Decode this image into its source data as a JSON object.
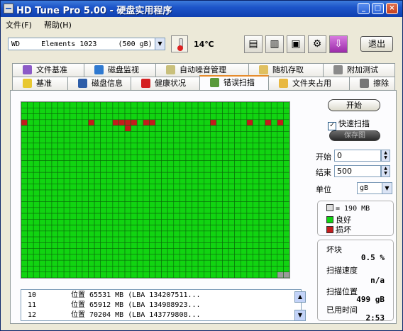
{
  "window": {
    "title": "HD Tune Pro 5.00 - 硬盘实用程序"
  },
  "menubar": {
    "items": [
      "文件(F)",
      "帮助(H)"
    ]
  },
  "toolbar": {
    "drive": "WD     Elements 1023     (500 gB)",
    "temperature": "14℃",
    "exit_label": "退出"
  },
  "tabs_row1": [
    "文件基准",
    "磁盘监视",
    "自动噪音管理",
    "随机存取",
    "附加测试"
  ],
  "tabs_row2": [
    "基准",
    "磁盘信息",
    "健康状况",
    "错误扫描",
    "文件夹占用",
    "擦除"
  ],
  "scan": {
    "start_button": "开始",
    "quick_scan_label": "快速扫描",
    "quick_scan_checked": true,
    "save_button": "保存图",
    "start_label": "开始",
    "start_value": "0",
    "end_label": "结束",
    "end_value": "500",
    "unit_label": "单位",
    "unit_value": "gB",
    "legend_block": "= 190 MB",
    "legend_good": "良好",
    "legend_bad": "损坏",
    "bad_blocks_label": "坏块",
    "bad_blocks_value": "0.5 %",
    "speed_label": "扫描速度",
    "speed_value": "n/a",
    "position_label": "扫描位置",
    "position_value": "499 gB",
    "elapsed_label": "已用时间",
    "elapsed_value": "2:53"
  },
  "log": [
    {
      "n": "10",
      "text": "位置 65531 MB (LBA 134207511..."
    },
    {
      "n": "11",
      "text": "位置 65912 MB (LBA 134988923..."
    },
    {
      "n": "12",
      "text": "位置 70204 MB (LBA 143779808..."
    }
  ],
  "block_map": {
    "cols": 44,
    "rows": 30,
    "bad_blocks": [
      [
        0,
        3
      ],
      [
        11,
        3
      ],
      [
        15,
        3
      ],
      [
        16,
        3
      ],
      [
        17,
        3
      ],
      [
        17,
        4
      ],
      [
        18,
        3
      ],
      [
        20,
        3
      ],
      [
        21,
        3
      ],
      [
        31,
        3
      ],
      [
        37,
        3
      ],
      [
        40,
        3
      ],
      [
        42,
        3
      ]
    ],
    "unscanned_blocks": [
      [
        42,
        29
      ],
      [
        43,
        29
      ]
    ]
  },
  "colors": {
    "good": "#11d411",
    "bad": "#c41c1c",
    "unscanned": "#9a9a9a",
    "grid_line": "#0a6a0a",
    "title_bar": "#1d55c9"
  }
}
